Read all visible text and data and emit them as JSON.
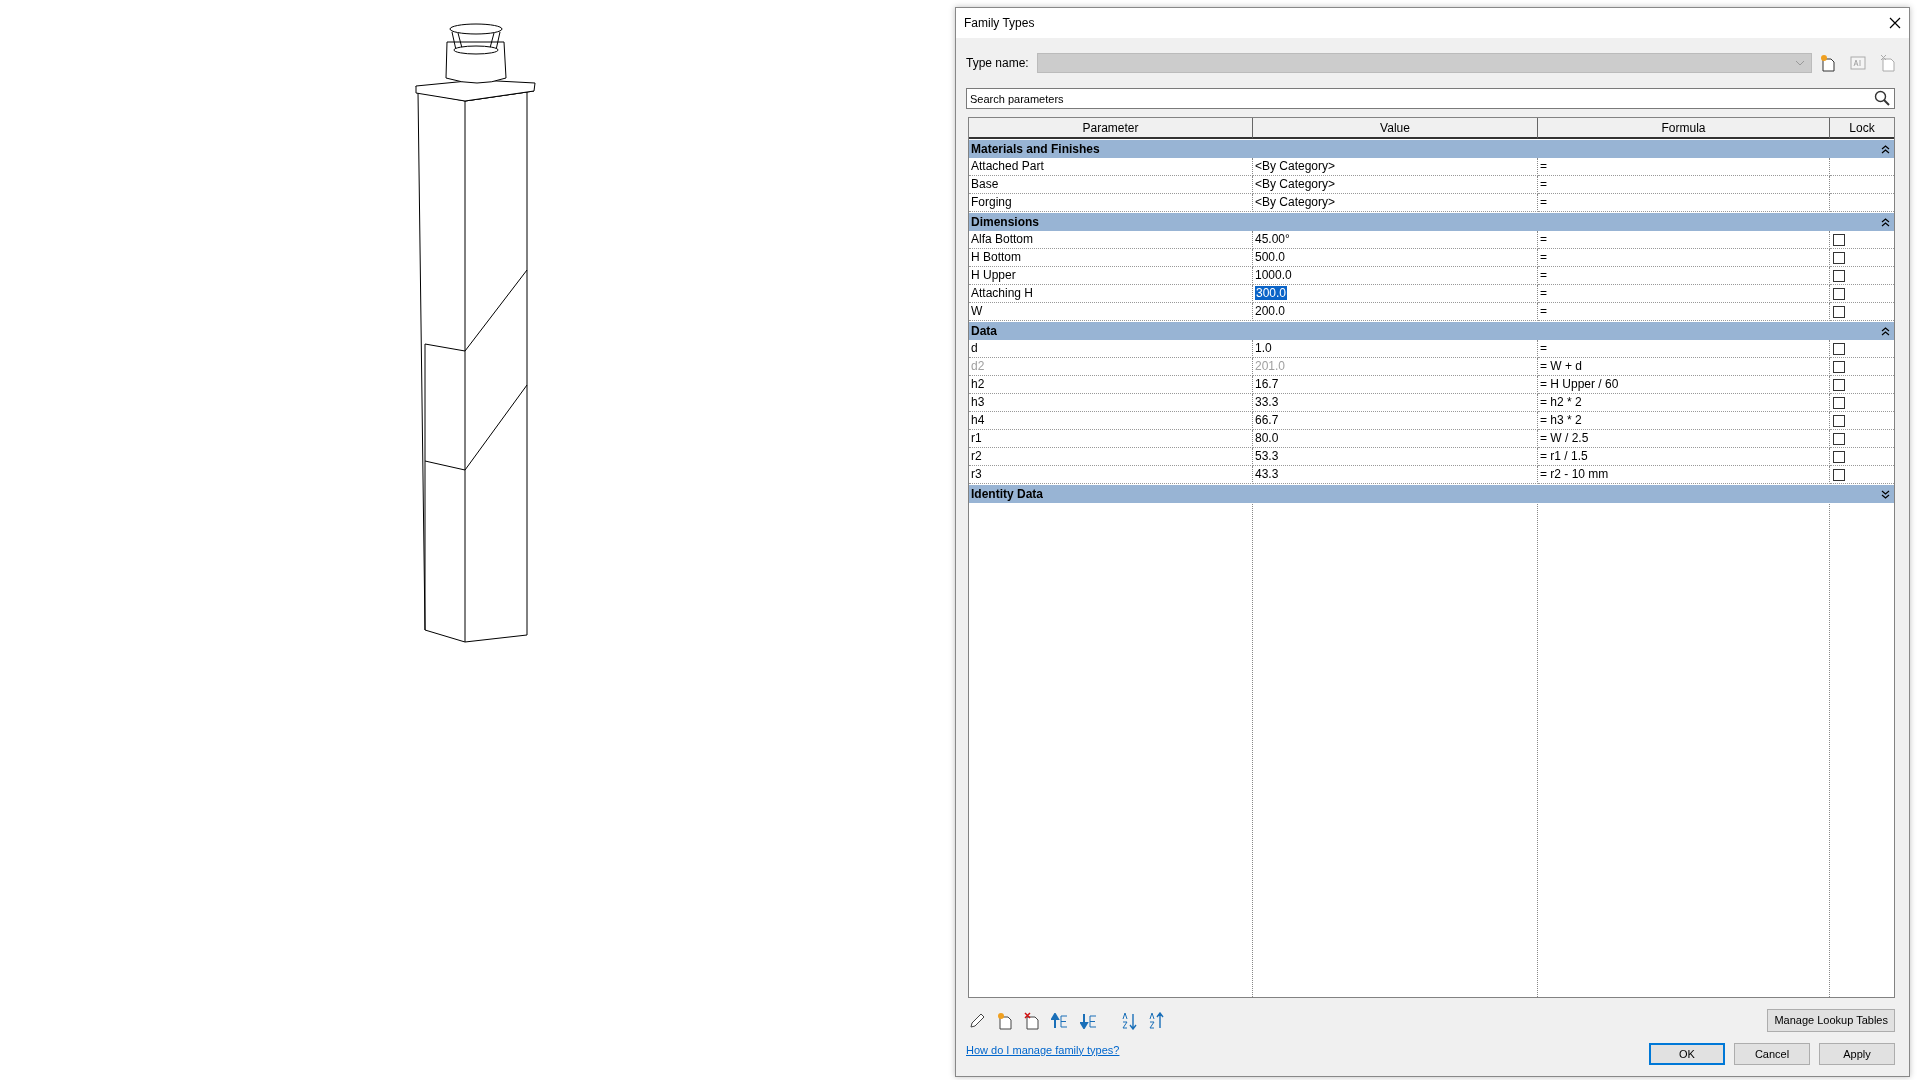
{
  "window": {
    "title": "Family Types"
  },
  "type_name": {
    "label": "Type name:",
    "disabled": true
  },
  "search": {
    "placeholder": "Search parameters"
  },
  "columns": [
    "Parameter",
    "Value",
    "Formula",
    "Lock"
  ],
  "sections": [
    {
      "title": "Materials and Finishes",
      "expanded": true,
      "rows": [
        {
          "name": "Attached Part",
          "value": "<By Category>",
          "formula": "=",
          "disabled": false,
          "selected": false
        },
        {
          "name": "Base",
          "value": "<By Category>",
          "formula": "=",
          "disabled": false,
          "selected": false
        },
        {
          "name": "Forging",
          "value": "<By Category>",
          "formula": "=",
          "disabled": false,
          "selected": false
        }
      ]
    },
    {
      "title": "Dimensions",
      "expanded": true,
      "rows": [
        {
          "name": "Alfa Bottom",
          "value": "45.00°",
          "formula": "=",
          "locked": false,
          "disabled": false,
          "selected": false
        },
        {
          "name": "H Bottom",
          "value": "500.0",
          "formula": "=",
          "locked": false,
          "disabled": false,
          "selected": false
        },
        {
          "name": "H Upper",
          "value": "1000.0",
          "formula": "=",
          "locked": false,
          "disabled": false,
          "selected": false
        },
        {
          "name": "Attaching H",
          "value": "300.0",
          "formula": "=",
          "locked": false,
          "disabled": false,
          "selected": true
        },
        {
          "name": "W",
          "value": "200.0",
          "formula": "=",
          "locked": false,
          "disabled": false,
          "selected": false
        }
      ]
    },
    {
      "title": "Data",
      "expanded": true,
      "rows": [
        {
          "name": "d",
          "value": "1.0",
          "formula": "=",
          "locked": false,
          "disabled": false,
          "selected": false
        },
        {
          "name": "d2",
          "value": "201.0",
          "formula": "= W + d",
          "locked": false,
          "disabled": true,
          "selected": false
        },
        {
          "name": "h2",
          "value": "16.7",
          "formula": "= H Upper / 60",
          "locked": false,
          "disabled": false,
          "selected": false
        },
        {
          "name": "h3",
          "value": "33.3",
          "formula": "= h2 * 2",
          "locked": false,
          "disabled": false,
          "selected": false
        },
        {
          "name": "h4",
          "value": "66.7",
          "formula": "= h3 * 2",
          "locked": false,
          "disabled": false,
          "selected": false
        },
        {
          "name": "r1",
          "value": "80.0",
          "formula": "= W / 2.5",
          "locked": false,
          "disabled": false,
          "selected": false
        },
        {
          "name": "r2",
          "value": "53.3",
          "formula": "= r1 / 1.5",
          "locked": false,
          "disabled": false,
          "selected": false
        },
        {
          "name": "r3",
          "value": "43.3",
          "formula": "= r2 - 10 mm",
          "locked": false,
          "disabled": false,
          "selected": false
        }
      ]
    },
    {
      "title": "Identity Data",
      "expanded": false
    }
  ],
  "buttons": {
    "manage": "Manage Lookup Tables",
    "help_link": "How do I manage family types?",
    "ok": "OK",
    "cancel": "Cancel",
    "apply": "Apply"
  }
}
